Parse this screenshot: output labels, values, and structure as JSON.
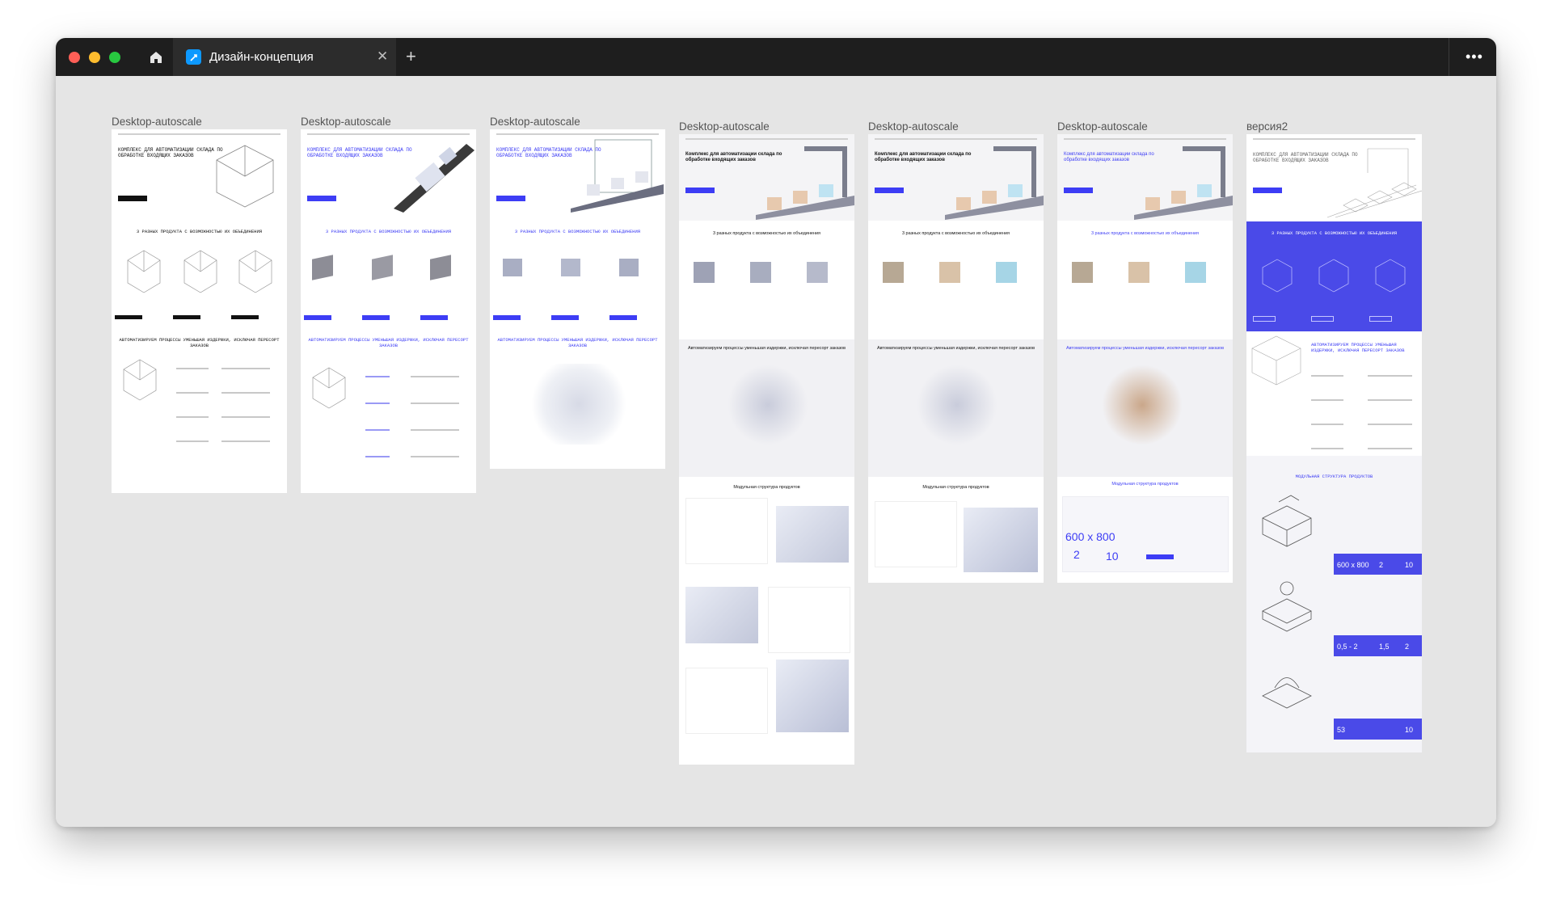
{
  "window": {
    "tab_title": "Дизайн-концепция",
    "tab_close_glyph": "✕",
    "new_tab_glyph": "+",
    "more_glyph": "•••"
  },
  "frames": [
    {
      "label": "Desktop-autoscale",
      "style": "mono",
      "hero_title": "КОМПЛЕКС ДЛЯ АВТОМАТИЗАЦИИ СКЛАДА ПО ОБРАБОТКЕ ВХОДЯЩИХ ЗАКАЗОВ",
      "section1": "3 РАЗНЫХ ПРОДУКТА С ВОЗМОЖНОСТЬЮ ИХ ОБЪЕДИНЕНИЯ",
      "section2": "АВТОМАТИЗИРУЕМ ПРОЦЕССЫ УМЕНЬШАЯ ИЗДЕРЖКИ, ИСКЛЮЧАЯ ПЕРЕСОРТ ЗАКАЗОВ"
    },
    {
      "label": "Desktop-autoscale",
      "style": "blue-mono",
      "hero_title": "КОМПЛЕКС ДЛЯ АВТОМАТИЗАЦИИ СКЛАДА ПО ОБРАБОТКЕ ВХОДЯЩИХ ЗАКАЗОВ",
      "section1": "3 РАЗНЫХ ПРОДУКТА С ВОЗМОЖНОСТЬЮ ИХ ОБЪЕДИНЕНИЯ",
      "section2": "АВТОМАТИЗИРУЕМ ПРОЦЕССЫ УМЕНЬШАЯ ИЗДЕРЖКИ, ИСКЛЮЧАЯ ПЕРЕСОРТ ЗАКАЗОВ"
    },
    {
      "label": "Desktop-autoscale",
      "style": "blue-mono",
      "hero_title": "КОМПЛЕКС ДЛЯ АВТОМАТИЗАЦИИ СКЛАДА ПО ОБРАБОТКЕ ВХОДЯЩИХ ЗАКАЗОВ",
      "section1": "3 РАЗНЫХ ПРОДУКТА С ВОЗМОЖНОСТЬЮ ИХ ОБЪЕДИНЕНИЯ",
      "section2": "АВТОМАТИЗИРУЕМ ПРОЦЕССЫ УМЕНЬШАЯ ИЗДЕРЖКИ, ИСКЛЮЧАЯ ПЕРЕСОРТ ЗАКАЗОВ"
    },
    {
      "label": "Desktop-autoscale",
      "style": "sans",
      "hero_title": "Комплекс для автоматизации склада по обработке входящих заказов",
      "section1": "3 разных продукта с возможностью их объединения",
      "section2": "Автоматизируем процессы уменьшая издержки, исключая пересорт заказов",
      "section3": "Модульная структура продуктов"
    },
    {
      "label": "Desktop-autoscale",
      "style": "sans",
      "hero_title": "Комплекс для автоматизации склада по обработке входящих заказов",
      "section1": "3 разных продукта с возможностью их объединения",
      "section2": "Автоматизируем процессы уменьшая издержки, исключая пересорт заказов",
      "section3": "Модульная структура продуктов"
    },
    {
      "label": "Desktop-autoscale",
      "style": "sans",
      "hero_title": "Комплекс для автоматизации склада по обработке входящих заказов",
      "section1": "3 разных продукта с возможностью их объединения",
      "section2": "Автоматизируем процессы уменьшая издержки, исключая пересорт заказов",
      "section3": "Модульная структура продуктов",
      "stat_a": "600 x 800",
      "stat_b": "2",
      "stat_c": "10"
    },
    {
      "label": "версия2",
      "style": "wire",
      "hero_title": "КОМПЛЕКС ДЛЯ АВТОМАТИЗАЦИИ СКЛАДА ПО ОБРАБОТКЕ ВХОДЯЩИХ ЗАКАЗОВ",
      "section1": "3 РАЗНЫХ ПРОДУКТА С ВОЗМОЖНОСТЬЮ ИХ ОБЪЕДИНЕНИЯ",
      "section2": "АВТОМАТИЗИРУЕМ ПРОЦЕССЫ УМЕНЬШАЯ ИЗДЕРЖКИ, ИСКЛЮЧАЯ ПЕРЕСОРТ ЗАКАЗОВ",
      "section3": "МОДУЛЬНАЯ СТРУКТУРА ПРОДУКТОВ",
      "stat_a": "600 x 800",
      "stat_b": "2",
      "stat_c": "10",
      "stat_d": "0,5 - 2",
      "stat_e": "1,5",
      "stat_f": "2",
      "stat_g": "53",
      "stat_h": "10"
    }
  ],
  "colors": {
    "accent": "#3d3df5",
    "titlebar": "#1e1e1e",
    "canvas": "#e5e5e5"
  }
}
